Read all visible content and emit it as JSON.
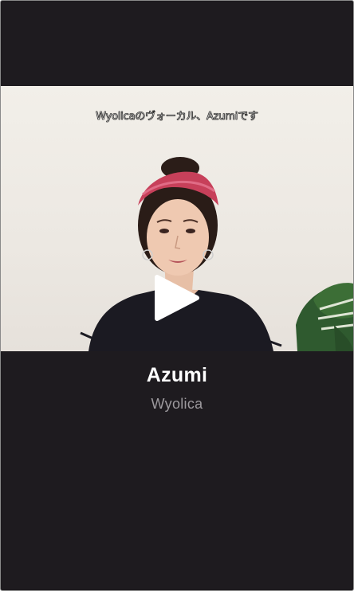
{
  "video": {
    "subtitle": "Wyolicaのヴォーカル、Azumiです",
    "play_icon": "play-icon"
  },
  "card": {
    "name": "Azumi",
    "artist": "Wyolica"
  },
  "colors": {
    "background": "#1e1b1f",
    "name_text": "#ffffff",
    "artist_text": "#9d9a9e"
  }
}
